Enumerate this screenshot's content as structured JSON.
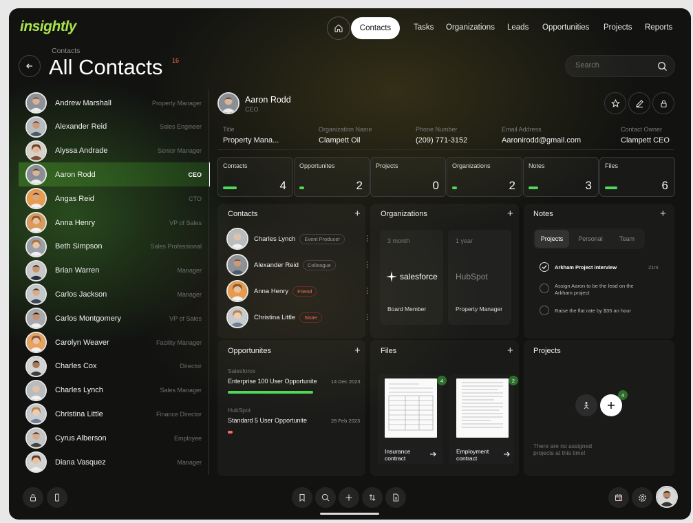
{
  "brand": {
    "logo": "insightly",
    "accent": "#a9e34b",
    "progress_color": "#4fd85a",
    "alert_color": "#ff6b5a"
  },
  "nav": {
    "home_icon": "home-icon",
    "items": [
      "Contacts",
      "Tasks",
      "Organizations",
      "Leads",
      "Opportunities",
      "Projects",
      "Reports"
    ],
    "active": "Contacts"
  },
  "header": {
    "breadcrumb": "Contacts",
    "title": "All Contacts",
    "count": "16"
  },
  "search": {
    "placeholder": "Search"
  },
  "contacts": [
    {
      "name": "Andrew Marshall",
      "role": "Property Manager"
    },
    {
      "name": "Alexander Reid",
      "role": "Sales Engineer"
    },
    {
      "name": "Alyssa Andrade",
      "role": "Senior Manager"
    },
    {
      "name": "Aaron Rodd",
      "role": "CEO",
      "active": true
    },
    {
      "name": "Angas Reid",
      "role": "CTO"
    },
    {
      "name": "Anna Henry",
      "role": "VP of Sales"
    },
    {
      "name": "Beth Simpson",
      "role": "Sales Professional"
    },
    {
      "name": "Brian Warren",
      "role": "Manager"
    },
    {
      "name": "Carlos Jackson",
      "role": "Manager"
    },
    {
      "name": "Carlos Montgomery",
      "role": "VP of Sales"
    },
    {
      "name": "Carolyn Weaver",
      "role": "Facility Manager"
    },
    {
      "name": "Charles Cox",
      "role": "Director"
    },
    {
      "name": "Charles Lynch",
      "role": "Sales Manager"
    },
    {
      "name": "Christina Little",
      "role": "Finance Director"
    },
    {
      "name": "Cyrus Alberson",
      "role": "Employee"
    },
    {
      "name": "Diana Vasquez",
      "role": "Manager"
    }
  ],
  "detail": {
    "name": "Aaron Rodd",
    "role": "CEO",
    "fields": [
      {
        "label": "Title",
        "value": "Property Mana..."
      },
      {
        "label": "Organization Name",
        "value": "Clampett Oil"
      },
      {
        "label": "Phone Number",
        "value": "(209) 771-3152"
      },
      {
        "label": "Email Address",
        "value": "Aaronirodd@gmail.com"
      },
      {
        "label": "Contact Owner",
        "value": "Clampett CEO"
      }
    ],
    "stats": [
      {
        "label": "Contacts",
        "value": "4"
      },
      {
        "label": "Opportunites",
        "value": "2"
      },
      {
        "label": "Projects",
        "value": "0"
      },
      {
        "label": "Organizations",
        "value": "2"
      },
      {
        "label": "Notes",
        "value": "3"
      },
      {
        "label": "Files",
        "value": "6"
      }
    ]
  },
  "panels": {
    "contacts": {
      "title": "Contacts",
      "items": [
        {
          "name": "Charles Lynch",
          "tag": "Event Producer"
        },
        {
          "name": "Alexander Reid",
          "tag": "Colleague"
        },
        {
          "name": "Anna Henry",
          "tag": "Friend"
        },
        {
          "name": "Christina Little",
          "tag": "Sister"
        }
      ]
    },
    "organizations": {
      "title": "Organizations",
      "items": [
        {
          "period": "3 month",
          "brand": "salesforce",
          "role": "Board Member"
        },
        {
          "period": "1 year",
          "brand": "HubSpot",
          "role": "Property Manager"
        }
      ]
    },
    "notes": {
      "title": "Notes",
      "tabs": [
        "Projects",
        "Personal",
        "Team"
      ],
      "items": [
        {
          "text": "Arkham Project interview",
          "time": "21m",
          "done": true
        },
        {
          "text": "Assign Aaron to be the lead on the Arkham project",
          "done": false
        },
        {
          "text": "Raise the flat rate by $35 an hour",
          "done": false
        }
      ]
    },
    "opportunities": {
      "title": "Opportunites",
      "items": [
        {
          "company": "Salesforce",
          "name": "Enterprise 100 User Opportunite",
          "date": "14 Dec 2023",
          "progress": 0.92
        },
        {
          "company": "HubSpot",
          "name": "Standard 5 User Opportunite",
          "date": "28 Feb 2023",
          "progress": 0.05
        }
      ]
    },
    "files": {
      "title": "Files",
      "items": [
        {
          "name": "Insurance contract",
          "count": "4"
        },
        {
          "name": "Employment contract",
          "count": "2"
        }
      ]
    },
    "projects": {
      "title": "Projects",
      "badge": "4",
      "empty": "There are no assigned projects at this time!"
    }
  },
  "footer": {
    "left_icons": [
      "lock-icon",
      "phone-icon"
    ],
    "center_icons": [
      "bookmark-icon",
      "search-icon",
      "plus-icon",
      "sort-icon",
      "document-icon"
    ],
    "right_icons": [
      "calendar-icon",
      "gear-icon",
      "avatar"
    ]
  }
}
